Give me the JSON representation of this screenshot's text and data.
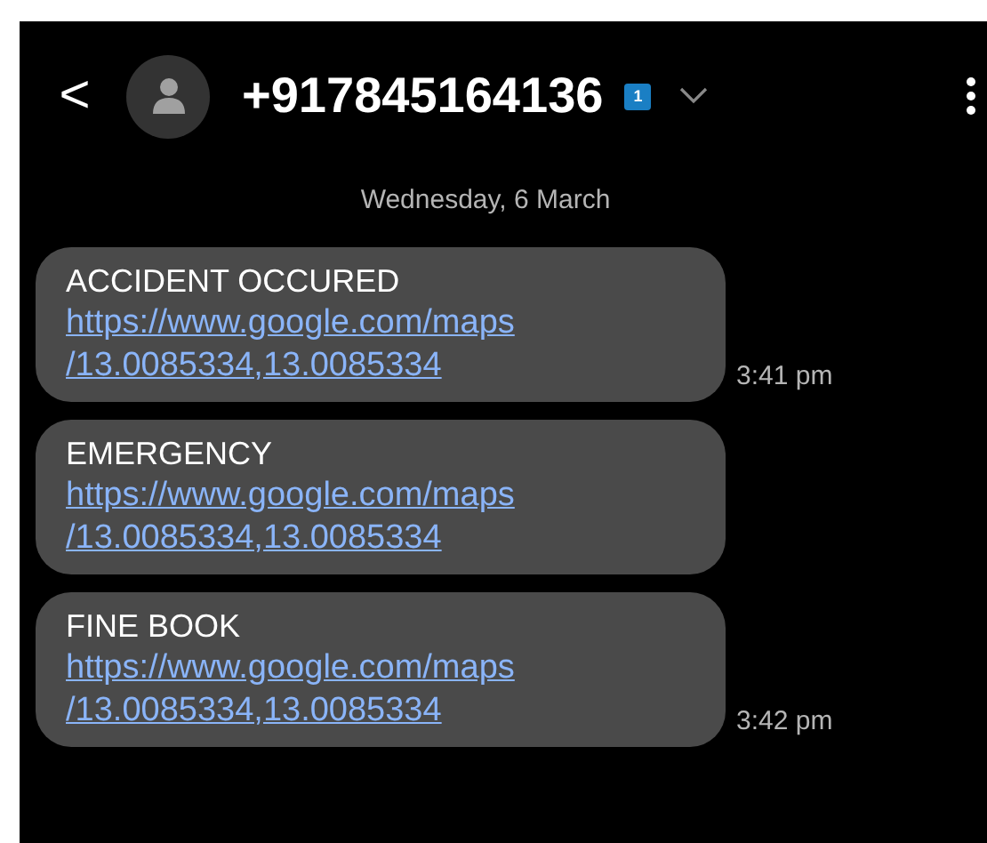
{
  "header": {
    "back": "<",
    "contact": "+917845164136",
    "sim_badge": "1"
  },
  "date": "Wednesday, 6 March",
  "messages": [
    {
      "text": "ACCIDENT OCCURED",
      "link_lines": [
        "https://www.google.com/maps",
        "/13.0085334,13.0085334"
      ],
      "time": "3:41 pm"
    },
    {
      "text": "EMERGENCY",
      "link_lines": [
        "https://www.google.com/maps",
        "/13.0085334,13.0085334"
      ]
    },
    {
      "text": "FINE BOOK",
      "link_lines": [
        "https://www.google.com/maps",
        "/13.0085334,13.0085334"
      ],
      "time": "3:42 pm"
    }
  ]
}
